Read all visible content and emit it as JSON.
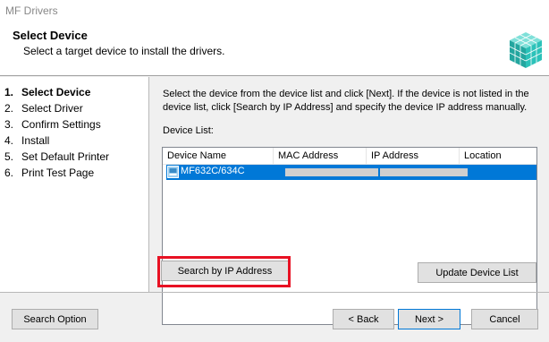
{
  "window": {
    "title": "MF Drivers"
  },
  "header": {
    "title": "Select Device",
    "subtitle": "Select a target device to install the drivers."
  },
  "steps": [
    {
      "num": "1.",
      "label": "Select Device",
      "active": true
    },
    {
      "num": "2.",
      "label": "Select Driver",
      "active": false
    },
    {
      "num": "3.",
      "label": "Confirm Settings",
      "active": false
    },
    {
      "num": "4.",
      "label": "Install",
      "active": false
    },
    {
      "num": "5.",
      "label": "Set Default Printer",
      "active": false
    },
    {
      "num": "6.",
      "label": "Print Test Page",
      "active": false
    }
  ],
  "content": {
    "instructions": "Select the device from the device list and click [Next]. If the device is not listed in the device list, click [Search by IP Address] and specify the device IP address manually.",
    "device_list_label": "Device List:",
    "columns": [
      "Device Name",
      "MAC Address",
      "IP Address",
      "Location"
    ],
    "rows": [
      {
        "device_name": "MF632C/634C",
        "mac_address": "",
        "ip_address": "",
        "location": "",
        "selected": true
      }
    ]
  },
  "buttons": {
    "search_by_ip": "Search by IP Address",
    "update_device_list": "Update Device List",
    "search_option": "Search Option",
    "back": "< Back",
    "next": "Next >",
    "cancel": "Cancel"
  },
  "colors": {
    "selection": "#0078d7",
    "highlight_box": "#e81123",
    "logo_teal": "#2bb8b0"
  }
}
